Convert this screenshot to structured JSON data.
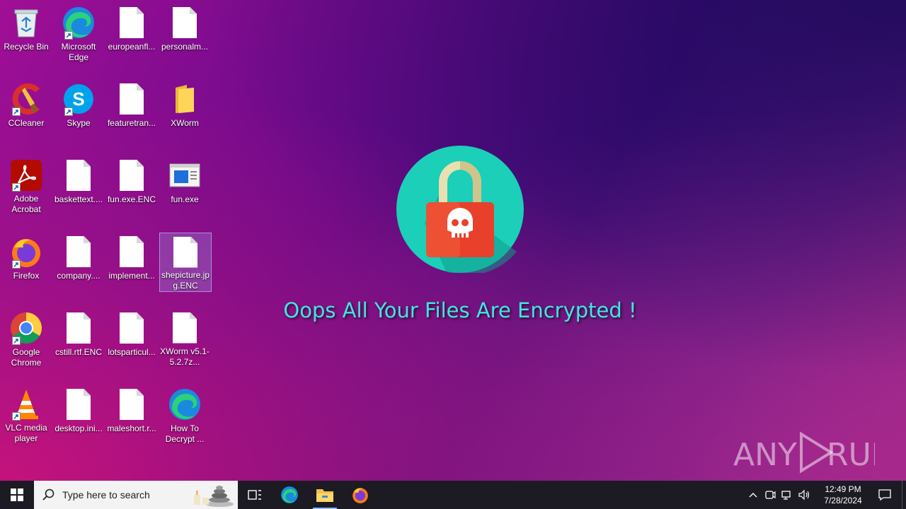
{
  "desktop": {
    "icons": [
      {
        "label": "Recycle Bin"
      },
      {
        "label": "Microsoft Edge"
      },
      {
        "label": "europeanfl..."
      },
      {
        "label": "personalm..."
      },
      {
        "label": "CCleaner"
      },
      {
        "label": "Skype"
      },
      {
        "label": "featuretran..."
      },
      {
        "label": "XWorm"
      },
      {
        "label": "Adobe Acrobat"
      },
      {
        "label": "baskettext...."
      },
      {
        "label": "fun.exe.ENC"
      },
      {
        "label": "fun.exe"
      },
      {
        "label": "Firefox"
      },
      {
        "label": "company...."
      },
      {
        "label": "implement..."
      },
      {
        "label": "shepicture.jpg.ENC"
      },
      {
        "label": "Google Chrome"
      },
      {
        "label": "cstill.rtf.ENC"
      },
      {
        "label": "lotsparticul..."
      },
      {
        "label": "XWorm v5.1-5.2.7z..."
      },
      {
        "label": "VLC media player"
      },
      {
        "label": "desktop.ini..."
      },
      {
        "label": "maleshort.r..."
      },
      {
        "label": "How To Decrypt ..."
      }
    ],
    "headline": "Oops All Your Files Are Encrypted !",
    "watermark": "ANY RUN"
  },
  "taskbar": {
    "search_placeholder": "Type here to search",
    "clock_time": "12:49 PM",
    "clock_date": "7/28/2024"
  },
  "colors": {
    "headline": "#3fe6e0",
    "lock_circle": "#1ccfb8",
    "lock_body": "#e8402a",
    "taskbar": "#1c1a22"
  }
}
